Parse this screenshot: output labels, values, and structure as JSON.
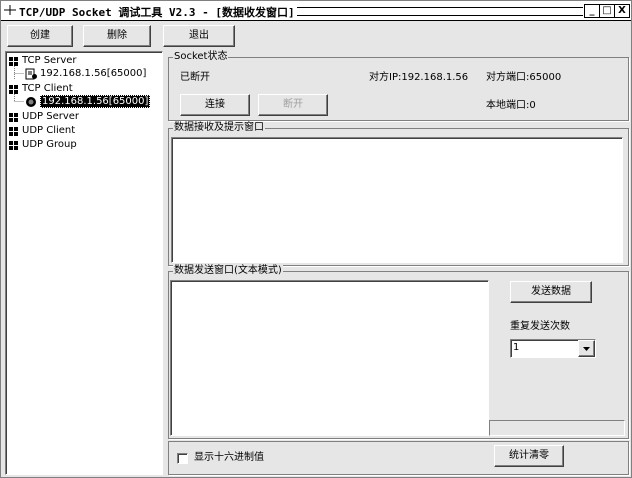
{
  "window": {
    "title": "TCP/UDP Socket 调试工具 V2.3 - [数据收发窗口]",
    "controls": {
      "minimize": "_",
      "maximize": "□",
      "close": "X"
    }
  },
  "toolbar": {
    "create_label": "创建",
    "delete_label": "删除",
    "exit_label": "退出"
  },
  "tree": {
    "tcp_server": "TCP Server",
    "tcp_server_child": "192.168.1.56[65000]",
    "tcp_client": "TCP Client",
    "tcp_client_child": "192.168.1.56[65000]",
    "udp_server": "UDP Server",
    "udp_client": "UDP Client",
    "udp_group": "UDP Group"
  },
  "socket_status": {
    "group_title": "Socket状态",
    "state": "已断开",
    "remote_ip": "对方IP:192.168.1.56",
    "remote_port": "对方端口:65000",
    "local_port": "本地端口:0",
    "connect_label": "连接",
    "disconnect_label": "断开"
  },
  "receive": {
    "group_title": "数据接收及提示窗口"
  },
  "send": {
    "group_title": "数据发送窗口(文本模式)",
    "send_button": "发送数据",
    "repeat_label": "重复发送次数",
    "repeat_value": "1"
  },
  "footer": {
    "hex_checkbox_label": "显示十六进制值",
    "hex_checked": false,
    "stats_clear_label": "统计清零"
  }
}
